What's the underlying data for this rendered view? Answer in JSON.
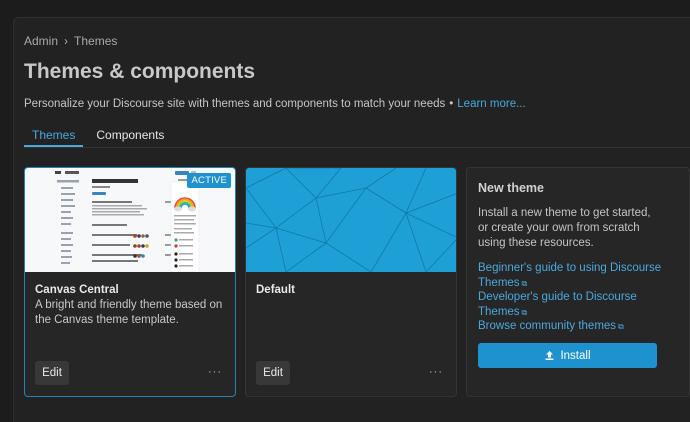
{
  "breadcrumb": {
    "admin": "Admin",
    "separator": "›",
    "current": "Themes"
  },
  "page": {
    "title": "Themes & components",
    "description": "Personalize your Discourse site with themes and components to match your needs",
    "dot": "•",
    "learn_more": "Learn more..."
  },
  "tabs": [
    {
      "label": "Themes",
      "active": true
    },
    {
      "label": "Components",
      "active": false
    }
  ],
  "themes": [
    {
      "name": "Canvas Central",
      "description": "A bright and friendly theme based on the Canvas theme template.",
      "badge": "ACTIVE",
      "edit_label": "Edit",
      "more_label": "···"
    },
    {
      "name": "Default",
      "description": "",
      "edit_label": "Edit",
      "more_label": "···"
    }
  ],
  "new_theme": {
    "title": "New theme",
    "description": "Install a new theme to get started, or create your own from scratch using these resources.",
    "links": [
      {
        "line1": "Beginner's guide to using Discourse",
        "line2": "Themes"
      },
      {
        "line1": "Developer's guide to Discourse",
        "line2": "Themes"
      },
      {
        "line1": "Browse community themes",
        "line2": ""
      }
    ],
    "install_label": "Install"
  },
  "colors": {
    "accent": "#4aa8de",
    "primary_button": "#1e91cf",
    "background": "#1c1c1c",
    "card": "#262626"
  },
  "icons": {
    "breadcrumb_sep": "chevron-right-icon",
    "external_link": "external-link-icon",
    "install": "upload-icon",
    "more": "ellipsis-icon"
  }
}
